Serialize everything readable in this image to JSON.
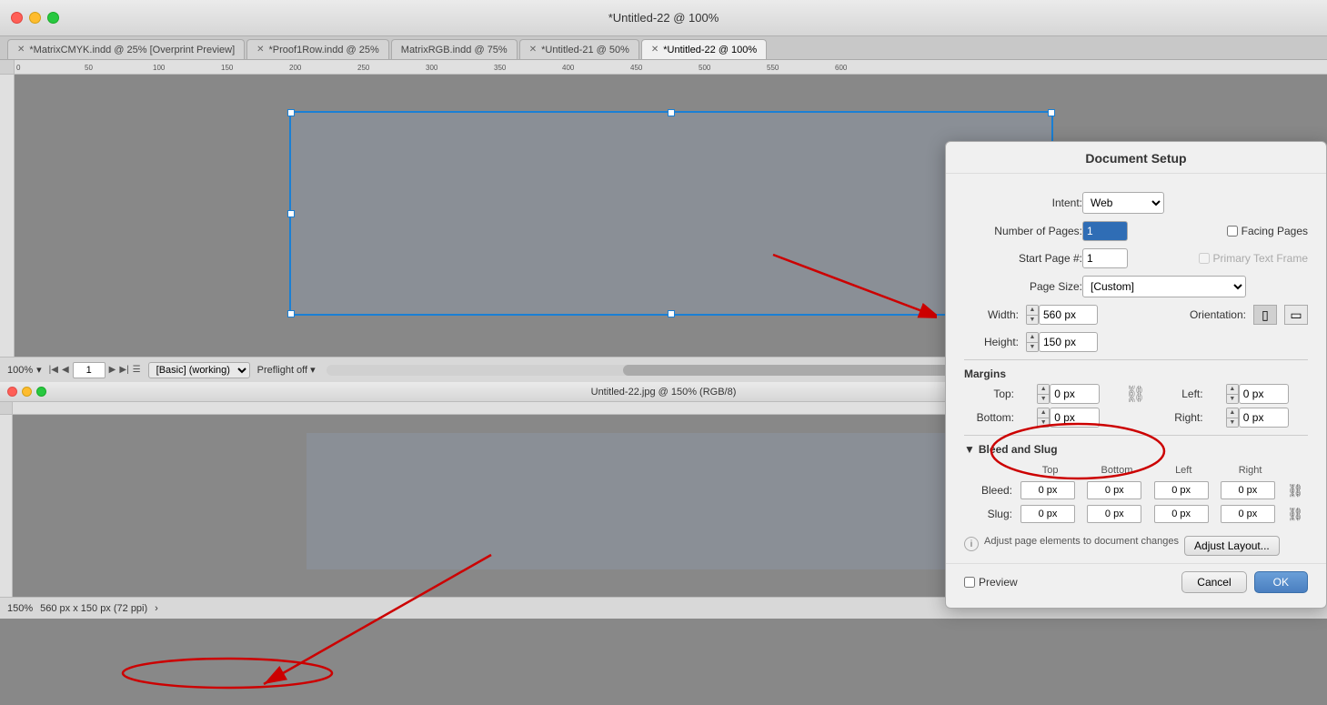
{
  "window": {
    "title": "*Untitled-22 @ 100%",
    "controls": {
      "close": "●",
      "min": "●",
      "max": "●"
    }
  },
  "tabs": [
    {
      "id": "tab1",
      "label": "*MatrixCMYK.indd @ 25% [Overprint Preview]",
      "active": false
    },
    {
      "id": "tab2",
      "label": "*Proof1Row.indd @ 25%",
      "active": false
    },
    {
      "id": "tab3",
      "label": "MatrixRGB.indd @ 75%",
      "active": false
    },
    {
      "id": "tab4",
      "label": "*Untitled-21 @ 50%",
      "active": false
    },
    {
      "id": "tab5",
      "label": "*Untitled-22 @ 100%",
      "active": true
    }
  ],
  "statusbar": {
    "zoom": "100%",
    "page": "1",
    "mode": "[Basic] (working)",
    "preflight": "Preflight off"
  },
  "bottom_window": {
    "title": "Untitled-22.jpg @ 150% (RGB/8)",
    "zoom": "150%",
    "dimensions": "560 px x 150 px (72 ppi)"
  },
  "doc_setup": {
    "title": "Document Setup",
    "intent_label": "Intent:",
    "intent_value": "Web",
    "num_pages_label": "Number of Pages:",
    "num_pages_value": "1",
    "start_page_label": "Start Page #:",
    "start_page_value": "1",
    "facing_pages_label": "Facing Pages",
    "primary_text_label": "Primary Text Frame",
    "page_size_label": "Page Size:",
    "page_size_value": "[Custom]",
    "width_label": "Width:",
    "width_value": "560 px",
    "height_label": "Height:",
    "height_value": "150 px",
    "orientation_label": "Orientation:",
    "margins_section": "Margins",
    "margins": {
      "top_label": "Top:",
      "top_value": "0 px",
      "bottom_label": "Bottom:",
      "bottom_value": "0 px",
      "left_label": "Left:",
      "left_value": "0 px",
      "right_label": "Right:",
      "right_value": "0 px"
    },
    "bleed_slug_label": "Bleed and Slug",
    "bleed_table": {
      "headers": [
        "Top",
        "Bottom",
        "Left",
        "Right"
      ],
      "bleed_label": "Bleed:",
      "bleed_values": [
        "0 px",
        "0 px",
        "0 px",
        "0 px"
      ],
      "slug_label": "Slug:",
      "slug_values": [
        "0 px",
        "0 px",
        "0 px",
        "0 px"
      ]
    },
    "adjust_info": "Adjust page elements to document changes",
    "adjust_btn": "Adjust Layout...",
    "preview_label": "Preview",
    "cancel_btn": "Cancel",
    "ok_btn": "OK"
  }
}
